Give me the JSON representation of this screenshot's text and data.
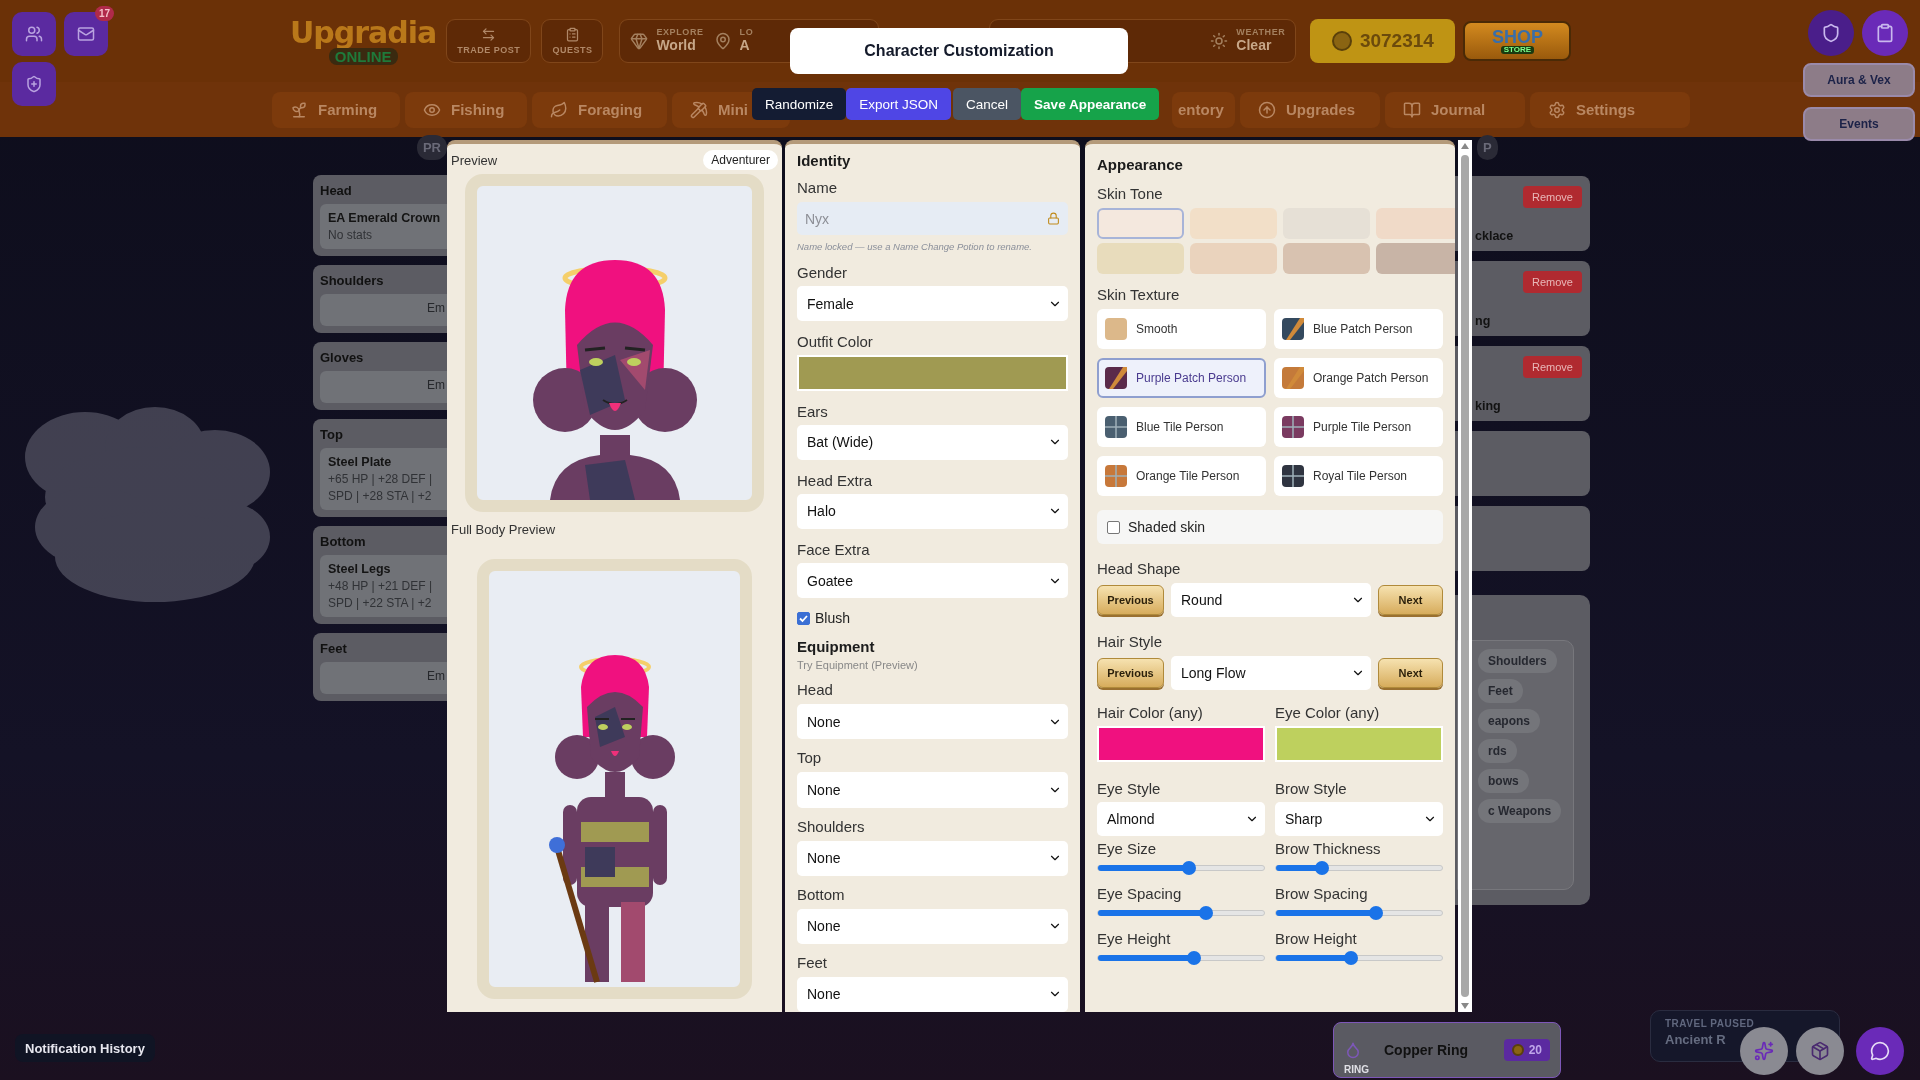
{
  "top_left": {
    "mail_badge": "17"
  },
  "logo": {
    "title": "Upgradia",
    "subtitle": "ONLINE"
  },
  "header_buttons": [
    {
      "kind": "trade",
      "label": "TRADE POST"
    },
    {
      "kind": "quests",
      "label": "QUESTS"
    }
  ],
  "status": [
    {
      "kind": "explore",
      "label": "EXPLORE",
      "value": "World"
    },
    {
      "kind": "location",
      "label": "LO",
      "value": "A"
    }
  ],
  "status_right": [
    {
      "kind": "weather",
      "label": "WEATHER",
      "value": "Clear"
    }
  ],
  "gold": "3072314",
  "shop": {
    "title": "SHOP",
    "subtitle": "STORE"
  },
  "side_buttons": [
    "Aura & Vex",
    "Events"
  ],
  "nav_tabs": [
    {
      "kind": "sprout",
      "label": "Farming"
    },
    {
      "kind": "eye",
      "label": "Fishing"
    },
    {
      "kind": "leaf",
      "label": "Foraging"
    },
    {
      "kind": "pick",
      "label": "Mini"
    },
    {
      "kind": "hidden",
      "label": "entory"
    },
    {
      "kind": "upgrade",
      "label": "Upgrades"
    },
    {
      "kind": "book",
      "label": "Journal"
    },
    {
      "kind": "gear",
      "label": "Settings"
    }
  ],
  "pills": {
    "left": "PR",
    "right": "P"
  },
  "equipment_slots": [
    {
      "slot": "Head",
      "item": "EA Emerald Crown",
      "stats": [
        "No stats"
      ]
    },
    {
      "slot": "Shoulders",
      "empty": "Em"
    },
    {
      "slot": "Gloves",
      "empty": "Em"
    },
    {
      "slot": "Top",
      "item": "Steel Plate",
      "stats": [
        "+65 HP | +28 DEF |",
        "SPD | +28 STA | +2"
      ]
    },
    {
      "slot": "Bottom",
      "item": "Steel Legs",
      "stats": [
        "+48 HP | +21 DEF |",
        "SPD | +22 STA | +2"
      ]
    },
    {
      "slot": "Feet",
      "empty": "Em"
    }
  ],
  "equipped_cards": [
    {
      "button": "Remove",
      "text": "cklace"
    },
    {
      "button": "Remove",
      "text": "ng"
    },
    {
      "button": "Remove",
      "text": "king"
    }
  ],
  "filter_chips": [
    "Shoulders",
    "Feet",
    "eapons",
    "rds",
    "bows",
    "c Weapons"
  ],
  "inventory_item": {
    "name": "Copper Ring",
    "price": "20",
    "type": "RING"
  },
  "travel": {
    "title": "TRAVEL PAUSED",
    "route": "Ancient R"
  },
  "notification_button": "Notification History",
  "modal": {
    "title": "Character Customization",
    "actions": [
      {
        "kind": "dark",
        "label": "Randomize"
      },
      {
        "kind": "indigo",
        "label": "Export JSON"
      },
      {
        "kind": "gray",
        "label": "Cancel"
      },
      {
        "kind": "green",
        "label": "Save Appearance"
      }
    ],
    "preview": {
      "title": "Preview",
      "badge": "Adventurer",
      "full_body_title": "Full Body Preview"
    },
    "identity": {
      "title": "Identity",
      "name_label": "Name",
      "name_placeholder": "Nyx",
      "name_hint": "Name locked — use a Name Change Potion to rename.",
      "fields": [
        {
          "kind": "select",
          "label": "Gender",
          "value": "Female"
        },
        {
          "kind": "color",
          "label": "Outfit Color",
          "color": "#a09a52"
        },
        {
          "kind": "select",
          "label": "Ears",
          "value": "Bat (Wide)"
        },
        {
          "kind": "select",
          "label": "Head Extra",
          "value": "Halo"
        },
        {
          "kind": "select",
          "label": "Face Extra",
          "value": "Goatee"
        }
      ],
      "blush": {
        "label": "Blush",
        "checked": true
      },
      "equipment_title": "Equipment",
      "equipment_hint": "Try Equipment (Preview)",
      "equipment": [
        {
          "label": "Head",
          "value": "None"
        },
        {
          "label": "Top",
          "value": "None"
        },
        {
          "label": "Shoulders",
          "value": "None"
        },
        {
          "label": "Bottom",
          "value": "None"
        },
        {
          "label": "Feet",
          "value": "None"
        }
      ]
    },
    "appearance": {
      "title": "Appearance",
      "skin_tone_label": "Skin Tone",
      "skin_tones": [
        {
          "color": "#f4e8de",
          "selected": true
        },
        {
          "color": "#f2dfc8",
          "selected": false
        },
        {
          "color": "#e6e0d6",
          "selected": false
        },
        {
          "color": "#f0dac8",
          "selected": false
        },
        {
          "color": "#e8dcbc",
          "selected": false
        },
        {
          "color": "#ead3bd",
          "selected": false
        },
        {
          "color": "#d8c2b0",
          "selected": false
        },
        {
          "color": "#c8b4a6",
          "selected": false
        }
      ],
      "skin_texture_label": "Skin Texture",
      "textures": [
        {
          "kind": "smooth",
          "label": "Smooth",
          "color": "#dcb88a",
          "selected": false
        },
        {
          "kind": "patch",
          "label": "Blue Patch Person",
          "color": "#34495e",
          "selected": false
        },
        {
          "kind": "patch",
          "label": "Purple Patch Person",
          "color": "#5a2a4a",
          "selected": true
        },
        {
          "kind": "patch",
          "label": "Orange Patch Person",
          "color": "#c47a3a",
          "selected": false
        },
        {
          "kind": "tile",
          "label": "Blue Tile Person",
          "color": "#4a5f70",
          "selected": false
        },
        {
          "kind": "tile",
          "label": "Purple Tile Person",
          "color": "#7a3a60",
          "selected": false
        },
        {
          "kind": "tile",
          "label": "Orange Tile Person",
          "color": "#c7783a",
          "selected": false
        },
        {
          "kind": "tile",
          "label": "Royal Tile Person",
          "color": "#2f3440",
          "selected": false
        }
      ],
      "shaded": {
        "label": "Shaded skin",
        "checked": false
      },
      "steppers": [
        {
          "label": "Head Shape",
          "previous": "Previous",
          "value": "Round",
          "next": "Next"
        },
        {
          "label": "Hair Style",
          "previous": "Previous",
          "value": "Long Flow",
          "next": "Next"
        }
      ],
      "colors": [
        {
          "label": "Hair Color (any)",
          "color": "#f0117f"
        },
        {
          "label": "Eye Color (any)",
          "color": "#bed05e"
        }
      ],
      "styles": [
        {
          "label": "Eye Style",
          "value": "Almond"
        },
        {
          "label": "Brow Style",
          "value": "Sharp"
        }
      ],
      "sliders": [
        {
          "label": "Eye Size",
          "level": 0.55
        },
        {
          "label": "Brow Thickness",
          "level": 0.28
        },
        {
          "label": "Eye Spacing",
          "level": 0.65
        },
        {
          "label": "Brow Spacing",
          "level": 0.6
        },
        {
          "label": "Eye Height",
          "level": 0.58
        },
        {
          "label": "Brow Height",
          "level": 0.45
        }
      ]
    }
  }
}
